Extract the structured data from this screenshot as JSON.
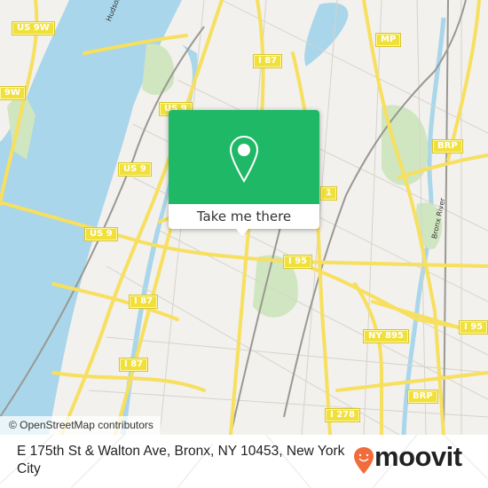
{
  "map": {
    "attribution": "© OpenStreetMap contributors",
    "road_shields": [
      {
        "id": "us9w-top",
        "label": "US 9W"
      },
      {
        "id": "9w-left",
        "label": "9W"
      },
      {
        "id": "us9-upper",
        "label": "US 9"
      },
      {
        "id": "us9-mid",
        "label": "US 9"
      },
      {
        "id": "us9-lower",
        "label": "US 9"
      },
      {
        "id": "i87-top",
        "label": "I 87"
      },
      {
        "id": "i87-mid",
        "label": "I 87"
      },
      {
        "id": "i87-low",
        "label": "I 87"
      },
      {
        "id": "mp",
        "label": "MP"
      },
      {
        "id": "brp-upper",
        "label": "BRP"
      },
      {
        "id": "brp-lower",
        "label": "BRP"
      },
      {
        "id": "i95-center",
        "label": "I 95"
      },
      {
        "id": "i95-right",
        "label": "I 95"
      },
      {
        "id": "ny895",
        "label": "NY 895"
      },
      {
        "id": "i278",
        "label": "I 278"
      },
      {
        "id": "one",
        "label": "1"
      }
    ],
    "water_labels": [
      {
        "id": "hudson",
        "label": "Hudson River"
      },
      {
        "id": "bronx",
        "label": "Bronx River"
      }
    ]
  },
  "popup": {
    "icon": "location-pin-icon",
    "button_label": "Take me there",
    "accent_color": "#1fb866"
  },
  "footer": {
    "address": "E 175th St & Walton Ave, Bronx, NY 10453, New York City",
    "brand": "moovit",
    "brand_color": "#f26b3a"
  }
}
